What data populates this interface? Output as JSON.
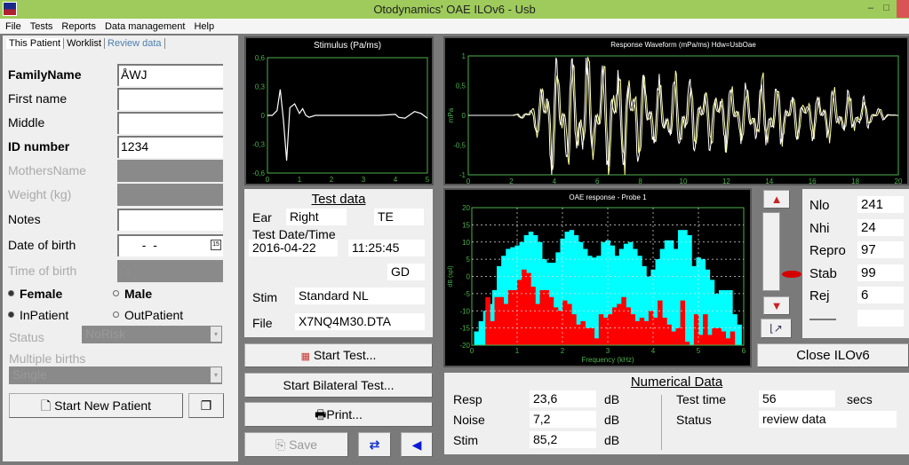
{
  "window": {
    "title": "Otodynamics' OAE   ILOv6 - Usb",
    "min": "–",
    "max": "□"
  },
  "menu": [
    "File",
    "Tests",
    "Reports",
    "Data management",
    "Help"
  ],
  "tabs": [
    {
      "label": "This Patient",
      "active": true
    },
    {
      "label": "Worklist"
    },
    {
      "label": "Review data"
    }
  ],
  "patient": {
    "family_name": {
      "label": "FamilyName",
      "value": "ÅWJ"
    },
    "first_name": {
      "label": "First name",
      "value": ""
    },
    "middle": {
      "label": "Middle",
      "value": ""
    },
    "id_number": {
      "label": "ID number",
      "value": "1234"
    },
    "mothers_name": {
      "label": "MothersName",
      "value": ""
    },
    "weight": {
      "label": "Weight (kg)",
      "value": ""
    },
    "notes": {
      "label": "Notes",
      "value": ""
    },
    "dob": {
      "label": "Date of birth",
      "value": "  -  -"
    },
    "tob": {
      "label": "Time of birth",
      "value": ":"
    },
    "gender": {
      "female": "Female",
      "male": "Male",
      "selected": "Female"
    },
    "patient_type": {
      "in": "InPatient",
      "out": "OutPatient",
      "selected": "InPatient"
    },
    "status": {
      "label": "Status",
      "value": "NoRisk"
    },
    "multiple_births": {
      "label": "Multiple births",
      "value": "Single"
    },
    "start_new_patient": "Start New Patient"
  },
  "test_data": {
    "title": "Test data",
    "ear_label": "Ear",
    "ear": "Right",
    "te": "TE",
    "datetime_label": "Test Date/Time",
    "date": "2016-04-22",
    "time": "11:25:45",
    "gd": "GD",
    "stim_label": "Stim",
    "stim": "Standard NL",
    "file_label": "File",
    "file": "X7NQ4M30.DTA"
  },
  "buttons": {
    "start_test": "Start Test...",
    "start_bilateral": "Start Bilateral Test...",
    "print": "Print...",
    "save": "Save",
    "close": "Close ILOv6"
  },
  "stats": [
    {
      "label": "Nlo",
      "value": "241"
    },
    {
      "label": "Nhi",
      "value": "24"
    },
    {
      "label": "Repro",
      "value": "97"
    },
    {
      "label": "Stab",
      "value": "99"
    },
    {
      "label": "Rej",
      "value": "6"
    },
    {
      "label": "——",
      "value": ""
    }
  ],
  "numerical": {
    "title": "Numerical Data",
    "resp": {
      "label": "Resp",
      "value": "23,6",
      "unit": "dB"
    },
    "noise": {
      "label": "Noise",
      "value": "7,2",
      "unit": "dB"
    },
    "stim": {
      "label": "Stim",
      "value": "85,2",
      "unit": "dB"
    },
    "test_time": {
      "label": "Test time",
      "value": "56",
      "unit": "secs"
    },
    "status": {
      "label": "Status",
      "value": "review data"
    }
  },
  "colors": {
    "grid": "#4cb04c",
    "response": "#00ffff",
    "noise": "#ff0000",
    "trace_a": "#ffff99",
    "trace_b": "#ffffff"
  },
  "chart_data": [
    {
      "type": "line",
      "title": "Stimulus (Pa/ms)",
      "xlim": [
        0,
        5
      ],
      "ylim": [
        -0.6,
        0.6
      ],
      "xticks": [
        "0",
        "1",
        "2",
        "3",
        "4",
        "5"
      ],
      "yticks": [
        "0,6",
        "0,3",
        "0",
        "-0,3",
        "-0,6"
      ],
      "x": [
        0,
        0.15,
        0.3,
        0.4,
        0.5,
        0.6,
        0.7,
        0.85,
        1.0,
        1.1,
        1.2,
        1.3,
        1.5,
        2,
        2.5,
        3,
        3.5,
        4,
        4.1,
        4.3,
        4.6,
        4.8,
        5
      ],
      "y": [
        0,
        0,
        0.05,
        0.27,
        -0.05,
        -0.47,
        0.08,
        0.12,
        0.02,
        0.07,
        0,
        -0.02,
        0,
        0,
        0,
        0,
        0,
        0.01,
        -0.02,
        -0.03,
        0.04,
        0.02,
        -0.03
      ]
    },
    {
      "type": "line",
      "title": "Response Waveform (mPa/ms) Hdw=UsbOae",
      "ylabel": "mPa",
      "xlim": [
        0,
        20
      ],
      "ylim": [
        -1,
        1
      ],
      "xticks": [
        "0",
        "2",
        "4",
        "6",
        "8",
        "10",
        "12",
        "14",
        "16",
        "18",
        "20"
      ],
      "yticks": [
        "1",
        "0,5",
        "0",
        "-0,5",
        "-1"
      ],
      "envelope": [
        [
          0,
          0
        ],
        [
          2,
          0
        ],
        [
          2.5,
          0.05
        ],
        [
          3,
          0.15
        ],
        [
          3.5,
          0.7
        ],
        [
          4,
          1
        ],
        [
          5,
          1
        ],
        [
          6,
          0.95
        ],
        [
          7,
          0.9
        ],
        [
          8,
          0.8
        ],
        [
          9,
          0.6
        ],
        [
          10,
          0.7
        ],
        [
          11,
          0.5
        ],
        [
          12,
          0.55
        ],
        [
          13,
          0.5
        ],
        [
          14,
          0.7
        ],
        [
          15,
          0.4
        ],
        [
          16,
          0.35
        ],
        [
          17,
          0.45
        ],
        [
          18,
          0.35
        ],
        [
          19,
          0.15
        ],
        [
          19.5,
          0.03
        ],
        [
          20,
          0
        ]
      ]
    },
    {
      "type": "bar",
      "title": "OAE response - Probe 1",
      "xlabel": "Frequency (kHz)",
      "ylabel": "dB (spl)",
      "xlim": [
        0,
        6
      ],
      "ylim": [
        -20,
        20
      ],
      "xticks": [
        "0",
        "1",
        "2",
        "3",
        "4",
        "5",
        "6"
      ],
      "yticks": [
        "20",
        "15",
        "10",
        "5",
        "0",
        "-5",
        "-10",
        "-15",
        "-20"
      ],
      "grid": true,
      "series": [
        {
          "name": "response",
          "x": [
            0.1,
            0.2,
            0.3,
            0.4,
            0.5,
            0.6,
            0.7,
            0.8,
            0.9,
            1.0,
            1.1,
            1.2,
            1.3,
            1.4,
            1.5,
            1.6,
            1.7,
            1.8,
            1.9,
            2.0,
            2.1,
            2.2,
            2.3,
            2.4,
            2.5,
            2.6,
            2.7,
            2.8,
            2.9,
            3.0,
            3.1,
            3.2,
            3.3,
            3.4,
            3.5,
            3.6,
            3.7,
            3.8,
            3.9,
            4.0,
            4.1,
            4.2,
            4.3,
            4.4,
            4.5,
            4.6,
            4.7,
            4.8,
            4.9,
            5.0,
            5.1,
            5.2,
            5.3,
            5.4,
            5.5,
            5.6,
            5.7,
            5.8,
            5.9
          ],
          "values": [
            -16,
            -13,
            -10,
            -8,
            -4,
            3,
            6,
            8,
            8.5,
            9,
            10,
            12,
            13,
            12,
            10,
            5,
            4,
            4,
            7,
            11,
            13,
            13.5,
            12,
            10,
            8,
            6,
            5.5,
            6,
            10,
            10.5,
            9,
            6,
            8,
            9.5,
            10,
            8,
            6,
            3,
            0,
            2,
            5,
            8,
            10.5,
            10.5,
            8,
            13.5,
            13.5,
            12,
            3,
            5.5,
            5,
            2,
            -1,
            -5,
            -4,
            -4,
            -4,
            -11,
            -14
          ]
        },
        {
          "name": "noise",
          "x": [
            0.35,
            0.45,
            0.55,
            0.65,
            0.75,
            0.85,
            0.95,
            1.05,
            1.15,
            1.25,
            1.35,
            1.45,
            1.55,
            1.65,
            1.75,
            1.85,
            1.95,
            2.05,
            2.15,
            2.25,
            2.35,
            2.45,
            2.55,
            2.65,
            2.75,
            2.85,
            2.95,
            3.05,
            3.15,
            3.25,
            3.35,
            3.45,
            3.55,
            3.65,
            3.75,
            3.85,
            3.95,
            4.05,
            4.15,
            4.25,
            4.35,
            4.45,
            4.55,
            4.65,
            4.75,
            4.85,
            4.95,
            5.05,
            5.15,
            5.25,
            5.35,
            5.45,
            5.55,
            5.65,
            5.75,
            5.85
          ],
          "values": [
            -6,
            -13,
            -6,
            -6,
            -8,
            -4,
            -4,
            -1,
            2,
            1,
            -3,
            -8,
            -4,
            -4,
            -6,
            -9,
            -10,
            -7,
            -8,
            -11,
            -14,
            -13,
            -15,
            -15,
            -18,
            -11,
            -12,
            -11,
            -9,
            -8,
            -6,
            -9,
            -11,
            -13,
            -12,
            -13,
            -10,
            -12,
            -7,
            -12,
            -14,
            -16,
            -15,
            -7,
            -19,
            -20,
            -11,
            -17,
            -11,
            -17,
            -15,
            -15,
            -16,
            -18,
            -16,
            -20
          ]
        }
      ]
    }
  ]
}
